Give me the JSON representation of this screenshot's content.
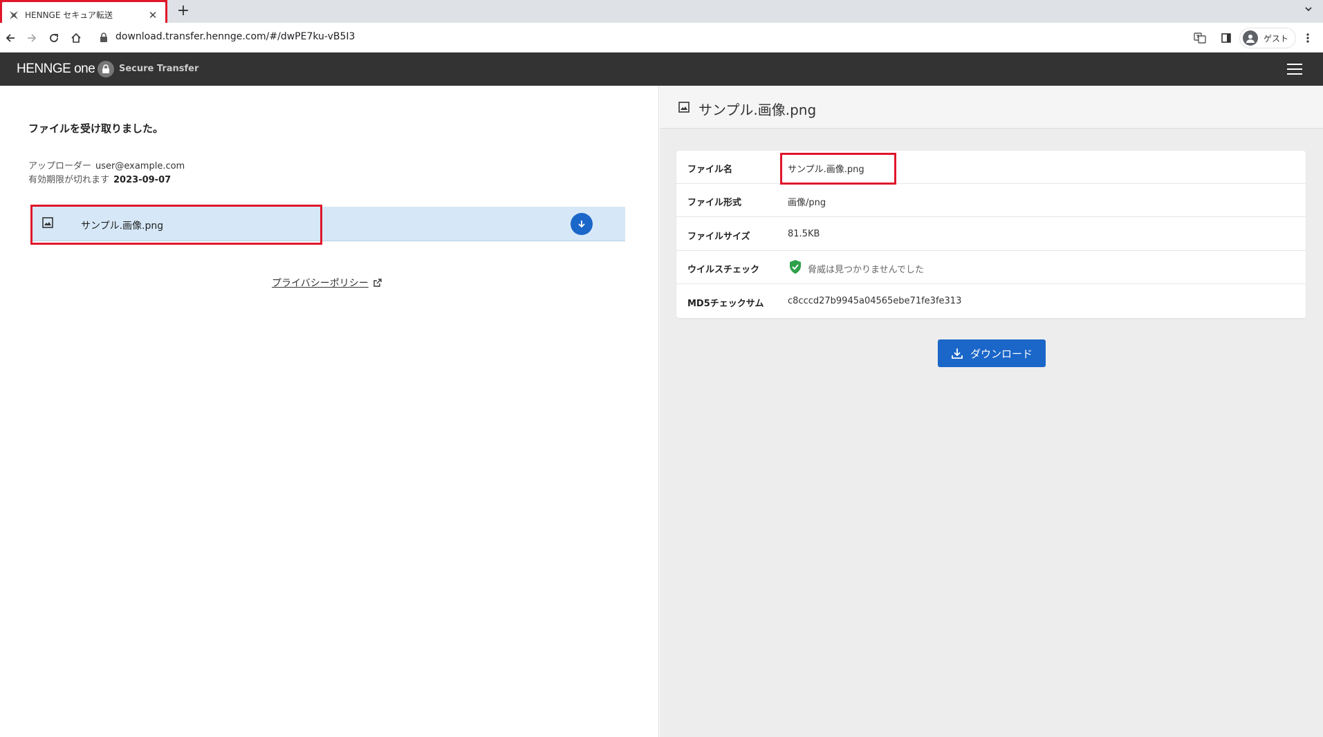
{
  "browser": {
    "tab_title": "HENNGE セキュア転送",
    "tab_close": "✕",
    "new_tab": "+",
    "url": "download.transfer.hennge.com/#/dwPE7ku-vB5I3",
    "profile_label": "ゲスト"
  },
  "header": {
    "brand": "HENNGE one",
    "product": "Secure Transfer"
  },
  "left": {
    "title": "ファイルを受け取りました。",
    "uploader_label": "アップローダー",
    "uploader_value": "user@example.com",
    "expiry_label": "有効期限が切れます",
    "expiry_value": "2023-09-07",
    "file_name": "サンプル.画像.png",
    "privacy_link": "プライバシーポリシー"
  },
  "detail": {
    "title": "サンプル.画像.png",
    "rows": [
      {
        "label": "ファイル名",
        "value": "サンプル.画像.png"
      },
      {
        "label": "ファイル形式",
        "value": "画像/png"
      },
      {
        "label": "ファイルサイズ",
        "value": "81.5KB"
      },
      {
        "label": "ウイルスチェック",
        "value": "脅威は見つかりませんでした"
      },
      {
        "label": "MD5チェックサム",
        "value": "c8cccd27b9945a04565ebe71fe3fe313"
      }
    ],
    "download_label": "ダウンロード"
  },
  "colors": {
    "highlight": "#e0162b",
    "accent": "#1a66c9",
    "header_bg": "#333333",
    "file_row_bg": "#d6e8f7",
    "check_green": "#2ea04a"
  },
  "icons": [
    "hennge-favicon-icon",
    "back-icon",
    "forward-icon",
    "reload-icon",
    "home-icon",
    "lock-icon",
    "translate-icon",
    "sidepanel-icon",
    "profile-icon",
    "kebab-menu-icon",
    "hamburger-menu-icon",
    "image-file-icon",
    "download-arrow-icon",
    "external-link-icon",
    "shield-check-icon"
  ]
}
